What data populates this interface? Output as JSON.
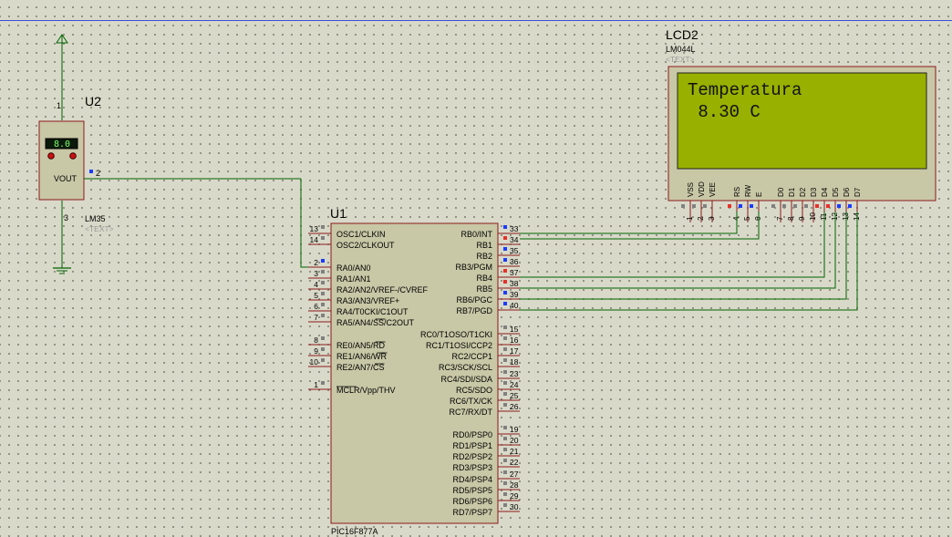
{
  "colors": {
    "background": "#d9d9c9",
    "wire": "#006400",
    "component_body": "#c8c7a6",
    "component_border": "#8b1a1a",
    "lcd_screen": "#98b000",
    "pin_gray": "#808080",
    "pin_red": "#e8302a",
    "pin_blue": "#1a3cff"
  },
  "sensor": {
    "ref": "U2",
    "model": "LM35",
    "text_placeholder": "<TEXT>",
    "display_value": "8.0",
    "output_label": "VOUT",
    "pin_top": "1",
    "pin_out": "2",
    "pin_bottom": "3"
  },
  "mcu": {
    "ref": "U1",
    "model": "PIC16F877A",
    "left_pins": [
      {
        "num": "13",
        "name": "OSC1/CLKIN"
      },
      {
        "num": "14",
        "name": "OSC2/CLKOUT"
      },
      {
        "num": "2",
        "name": "RA0/AN0"
      },
      {
        "num": "3",
        "name": "RA1/AN1"
      },
      {
        "num": "4",
        "name": "RA2/AN2/VREF-/CVREF"
      },
      {
        "num": "5",
        "name": "RA3/AN3/VREF+"
      },
      {
        "num": "6",
        "name": "RA4/T0CKI/C1OUT"
      },
      {
        "num": "7",
        "name": "RA5/AN4/SS/C2OUT"
      },
      {
        "num": "8",
        "name": "RE0/AN5/RD"
      },
      {
        "num": "9",
        "name": "RE1/AN6/WR"
      },
      {
        "num": "10",
        "name": "RE2/AN7/CS"
      },
      {
        "num": "1",
        "name": "MCLR/Vpp/THV"
      }
    ],
    "right_pins": [
      {
        "num": "33",
        "name": "RB0/INT"
      },
      {
        "num": "34",
        "name": "RB1"
      },
      {
        "num": "35",
        "name": "RB2"
      },
      {
        "num": "36",
        "name": "RB3/PGM"
      },
      {
        "num": "37",
        "name": "RB4"
      },
      {
        "num": "38",
        "name": "RB5"
      },
      {
        "num": "39",
        "name": "RB6/PGC"
      },
      {
        "num": "40",
        "name": "RB7/PGD"
      },
      {
        "num": "15",
        "name": "RC0/T1OSO/T1CKI"
      },
      {
        "num": "16",
        "name": "RC1/T1OSI/CCP2"
      },
      {
        "num": "17",
        "name": "RC2/CCP1"
      },
      {
        "num": "18",
        "name": "RC3/SCK/SCL"
      },
      {
        "num": "23",
        "name": "RC4/SDI/SDA"
      },
      {
        "num": "24",
        "name": "RC5/SDO"
      },
      {
        "num": "25",
        "name": "RC6/TX/CK"
      },
      {
        "num": "26",
        "name": "RC7/RX/DT"
      },
      {
        "num": "19",
        "name": "RD0/PSP0"
      },
      {
        "num": "20",
        "name": "RD1/PSP1"
      },
      {
        "num": "21",
        "name": "RD2/PSP2"
      },
      {
        "num": "22",
        "name": "RD3/PSP3"
      },
      {
        "num": "27",
        "name": "RD4/PSP4"
      },
      {
        "num": "28",
        "name": "RD5/PSP5"
      },
      {
        "num": "29",
        "name": "RD6/PSP6"
      },
      {
        "num": "30",
        "name": "RD7/PSP7"
      }
    ]
  },
  "lcd": {
    "ref": "LCD2",
    "model": "LM044L",
    "text_placeholder": "<TEXT>",
    "line1": "Temperatura",
    "line2": " 8.30 C",
    "pins": [
      {
        "num": "1",
        "name": "VSS"
      },
      {
        "num": "2",
        "name": "VDD"
      },
      {
        "num": "3",
        "name": "VEE"
      },
      {
        "num": "4",
        "name": "RS"
      },
      {
        "num": "5",
        "name": "RW"
      },
      {
        "num": "6",
        "name": "E"
      },
      {
        "num": "7",
        "name": "D0"
      },
      {
        "num": "8",
        "name": "D1"
      },
      {
        "num": "9",
        "name": "D2"
      },
      {
        "num": "10",
        "name": "D3"
      },
      {
        "num": "11",
        "name": "D4"
      },
      {
        "num": "12",
        "name": "D5"
      },
      {
        "num": "13",
        "name": "D6"
      },
      {
        "num": "14",
        "name": "D7"
      }
    ]
  }
}
